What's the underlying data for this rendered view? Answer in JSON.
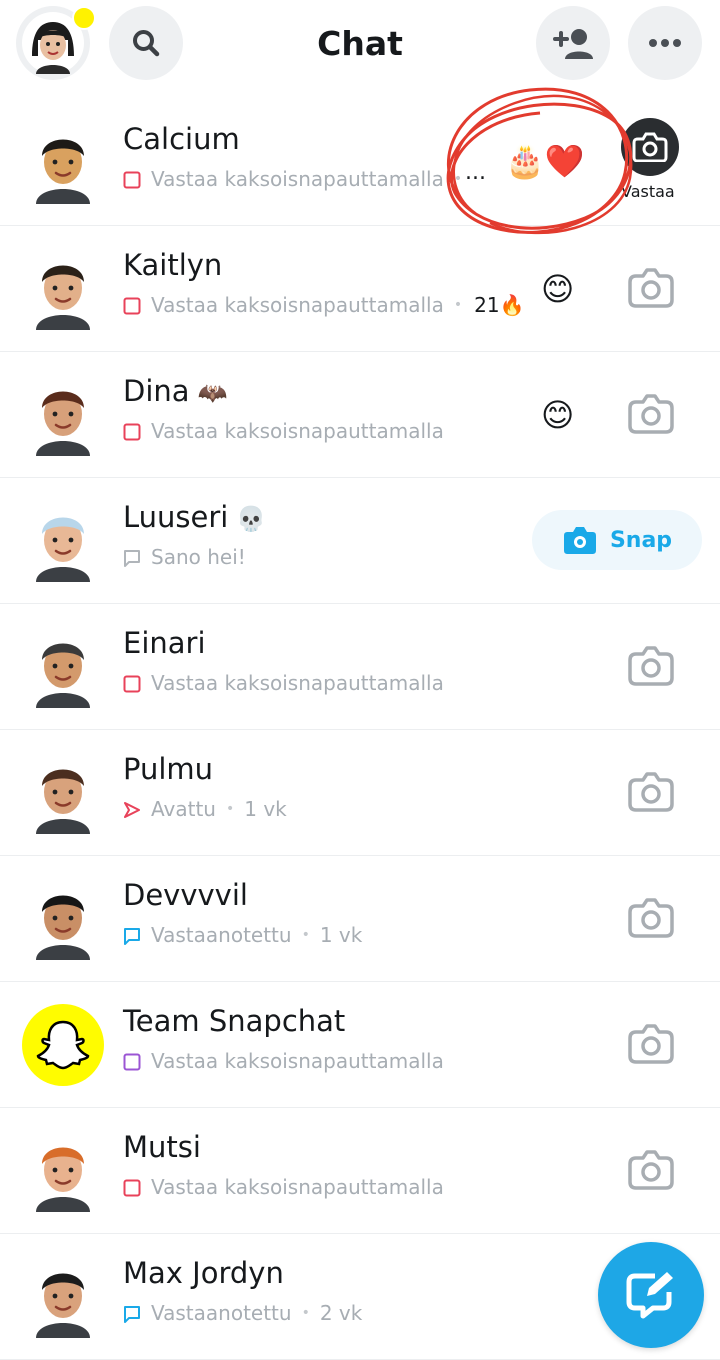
{
  "header": {
    "title": "Chat"
  },
  "chats": [
    {
      "name": "Calcium",
      "name_emoji": "",
      "status_icon": "red-square-icon",
      "status_text": "Vastaa kaksoisnapauttamalla",
      "time": "",
      "streak": "",
      "reaction": "",
      "typing": "...",
      "reaction_emojis": "🎂❤️",
      "action": "reply",
      "action_label": "Vastaa",
      "avatar_bg": "#ffffff",
      "avatar_skin": "#d9a15f",
      "avatar_hair": "#1d1a17"
    },
    {
      "name": "Kaitlyn",
      "name_emoji": "",
      "status_icon": "red-square-icon",
      "status_text": "Vastaa kaksoisnapauttamalla",
      "time": "",
      "streak": "21🔥",
      "reaction": "😊",
      "action": "camera",
      "avatar_bg": "#ffffff",
      "avatar_skin": "#e2b08a",
      "avatar_hair": "#2b2118"
    },
    {
      "name": "Dina",
      "name_emoji": "🦇",
      "status_icon": "red-square-icon",
      "status_text": "Vastaa kaksoisnapauttamalla",
      "time": "",
      "streak": "",
      "reaction": "😊",
      "action": "camera",
      "avatar_bg": "#ffffff",
      "avatar_skin": "#d7a07a",
      "avatar_hair": "#5a2c1c"
    },
    {
      "name": "Luuseri",
      "name_emoji": "💀",
      "status_icon": "grey-chat-icon",
      "status_text": "Sano hei!",
      "time": "",
      "streak": "",
      "reaction": "",
      "action": "snap",
      "action_label": "Snap",
      "avatar_bg": "#ffffff",
      "avatar_skin": "#e8b896",
      "avatar_hair": "#b8d6ea"
    },
    {
      "name": "Einari",
      "name_emoji": "",
      "status_icon": "red-square-icon",
      "status_text": "Vastaa kaksoisnapauttamalla",
      "time": "",
      "streak": "",
      "reaction": "",
      "action": "camera",
      "avatar_bg": "#ffffff",
      "avatar_skin": "#d39a6c",
      "avatar_hair": "#3a3a3a"
    },
    {
      "name": "Pulmu",
      "name_emoji": "",
      "status_icon": "red-arrow-icon",
      "status_text": "Avattu",
      "time": "1 vk",
      "streak": "",
      "reaction": "",
      "action": "camera",
      "avatar_bg": "#ffffff",
      "avatar_skin": "#d8a27c",
      "avatar_hair": "#4b2e1f"
    },
    {
      "name": "Devvvvil",
      "name_emoji": "",
      "status_icon": "blue-chat-icon",
      "status_text": "Vastaanotettu",
      "time": "1 vk",
      "streak": "",
      "reaction": "",
      "action": "camera",
      "avatar_bg": "#ffffff",
      "avatar_skin": "#c98f66",
      "avatar_hair": "#161616"
    },
    {
      "name": "Team Snapchat",
      "name_emoji": "",
      "status_icon": "purple-square-icon",
      "status_text": "Vastaa kaksoisnapauttamalla",
      "time": "",
      "streak": "",
      "reaction": "",
      "action": "camera",
      "avatar_bg": "#fffc00",
      "avatar_skin": "",
      "avatar_hair": ""
    },
    {
      "name": "Mutsi",
      "name_emoji": "",
      "status_icon": "red-square-icon",
      "status_text": "Vastaa kaksoisnapauttamalla",
      "time": "",
      "streak": "",
      "reaction": "",
      "action": "camera",
      "avatar_bg": "#ffffff",
      "avatar_skin": "#e8b28e",
      "avatar_hair": "#d86d2a"
    },
    {
      "name": "Max Jordyn",
      "name_emoji": "",
      "status_icon": "blue-chat-icon",
      "status_text": "Vastaanotettu",
      "time": "2 vk",
      "streak": "",
      "reaction": "",
      "action": "none",
      "avatar_bg": "#ffffff",
      "avatar_skin": "#d9a27c",
      "avatar_hair": "#1c1c1c"
    }
  ],
  "colors": {
    "red": "#e8425a",
    "blue": "#1aa9e8",
    "purple": "#9b55d4",
    "scribble": "#e23b2e",
    "fab": "#1ea7e6"
  },
  "icons": {
    "search": "search-icon",
    "add_friend": "add-friend-icon",
    "more": "more-icon",
    "camera": "camera-icon",
    "new_chat": "new-chat-icon"
  }
}
